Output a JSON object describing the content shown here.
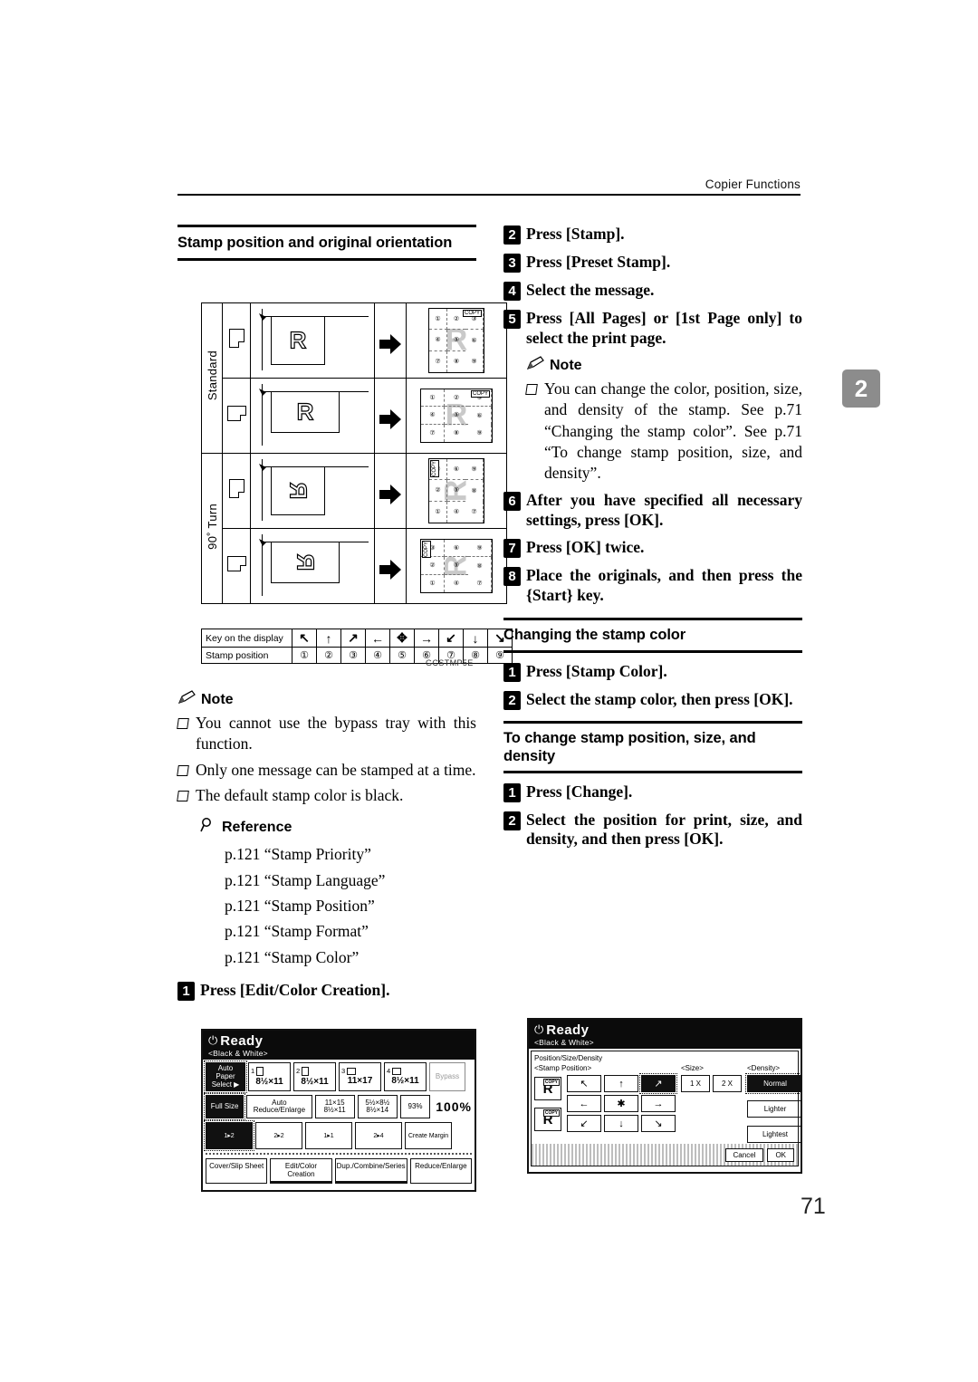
{
  "header": {
    "running_head": "Copier Functions"
  },
  "chapter_tab": "2",
  "page_number": "71",
  "figure": {
    "id_code": "GCSTMP5E",
    "row_labels": [
      "Standard",
      "90˚ Turn"
    ],
    "legend": {
      "key_label": "Key on the display",
      "pos_label": "Stamp position",
      "keys": [
        "↖",
        "↑",
        "↗",
        "←",
        "✥",
        "→",
        "↙",
        "↓",
        "↘"
      ],
      "positions": [
        "①",
        "②",
        "③",
        "④",
        "⑤",
        "⑥",
        "⑦",
        "⑧",
        "⑨"
      ]
    },
    "copy_tag": "COPY",
    "grid_numbers": [
      "①",
      "②",
      "③",
      "④",
      "⑤",
      "⑥",
      "⑦",
      "⑧",
      "⑨"
    ]
  },
  "left_column": {
    "section_title": "Stamp position and original orientation",
    "note_label": "Note",
    "notes": [
      "You cannot use the bypass tray with this function.",
      "Only one message can be stamped at a time.",
      "The default stamp color is black."
    ],
    "reference_label": "Reference",
    "references": [
      "p.121 “Stamp Priority”",
      "p.121 “Stamp Language”",
      "p.121 “Stamp Position”",
      "p.121 “Stamp Format”",
      "p.121 “Stamp Color”"
    ],
    "step1": {
      "num": "1",
      "text": "Press [Edit/Color Creation]."
    }
  },
  "right_column": {
    "steps": [
      {
        "num": "2",
        "text": "Press [Stamp]."
      },
      {
        "num": "3",
        "text": "Press [Preset Stamp]."
      },
      {
        "num": "4",
        "text": "Select the message."
      },
      {
        "num": "5",
        "text": "Press [All Pages] or [1st Page only] to select the print page."
      },
      {
        "num": "6",
        "text": "After you have specified all necessary settings, press [OK]."
      },
      {
        "num": "7",
        "text": "Press [OK] twice."
      },
      {
        "num": "8",
        "text": "Place the originals, and then press the {Start} key."
      }
    ],
    "note_label": "Note",
    "note_text": "You can change the color, position, size, and density of the stamp. See p.71 “Changing the stamp color”. See p.71 “To change stamp position, size, and density”.",
    "section_color": {
      "title": "Changing the stamp color",
      "steps": [
        {
          "num": "1",
          "text": "Press [Stamp Color]."
        },
        {
          "num": "2",
          "text": "Select the stamp color, then press [OK]."
        }
      ]
    },
    "section_position": {
      "title": "To change stamp position, size, and density",
      "steps": [
        {
          "num": "1",
          "text": "Press [Change]."
        },
        {
          "num": "2",
          "text": "Select the position for print, size, and density, and then press [OK]."
        }
      ]
    }
  },
  "lcd_copier": {
    "status": "Ready",
    "mode": "<Black & White>",
    "auto_paper_select": "Auto Paper Select ▶",
    "trays": [
      {
        "num": "1",
        "size": "8½×11",
        "orient": "portrait"
      },
      {
        "num": "2",
        "size": "8½×11",
        "orient": "portrait"
      },
      {
        "num": "3",
        "size": "11×17",
        "orient": "landscape"
      },
      {
        "num": "4",
        "size": "8½×11",
        "orient": "landscape"
      }
    ],
    "bypass_label": "Bypass",
    "full_size": "Full Size",
    "auto_reduce": "Auto Reduce/Enlarge",
    "ratio1_top": "11×15",
    "ratio1_bottom": "8½×11",
    "ratio2_top": "5½×8½",
    "ratio2_bottom": "8½×14",
    "ratio3": "93%",
    "zoom": "100%",
    "create_margin": "Create Margin",
    "tabs": [
      "Cover/Slip Sheet",
      "Edit/Color Creation",
      "Dup./Combine/Series",
      "Reduce/Enlarge"
    ],
    "active_tabs": [
      "Edit/Color Creation",
      "Dup./Combine/Series"
    ]
  },
  "lcd_position": {
    "status": "Ready",
    "mode": "<Black & White>",
    "panel_title": "Position/Size/Density",
    "group_position": "<Stamp Position>",
    "group_size": "<Size>",
    "group_density": "<Density>",
    "arrows": [
      "↖",
      "↑",
      "↗",
      "←",
      "✱",
      "→",
      "↙",
      "↓",
      "↘"
    ],
    "selected_arrow": "↗",
    "sizes": [
      "1 X",
      "2 X"
    ],
    "selected_size": "1 X",
    "densities": [
      "Normal",
      "Lighter",
      "Lightest"
    ],
    "selected_density": "Normal",
    "preview_letter": "R",
    "preview_tag": "COPY",
    "cancel": "Cancel",
    "ok": "OK"
  }
}
